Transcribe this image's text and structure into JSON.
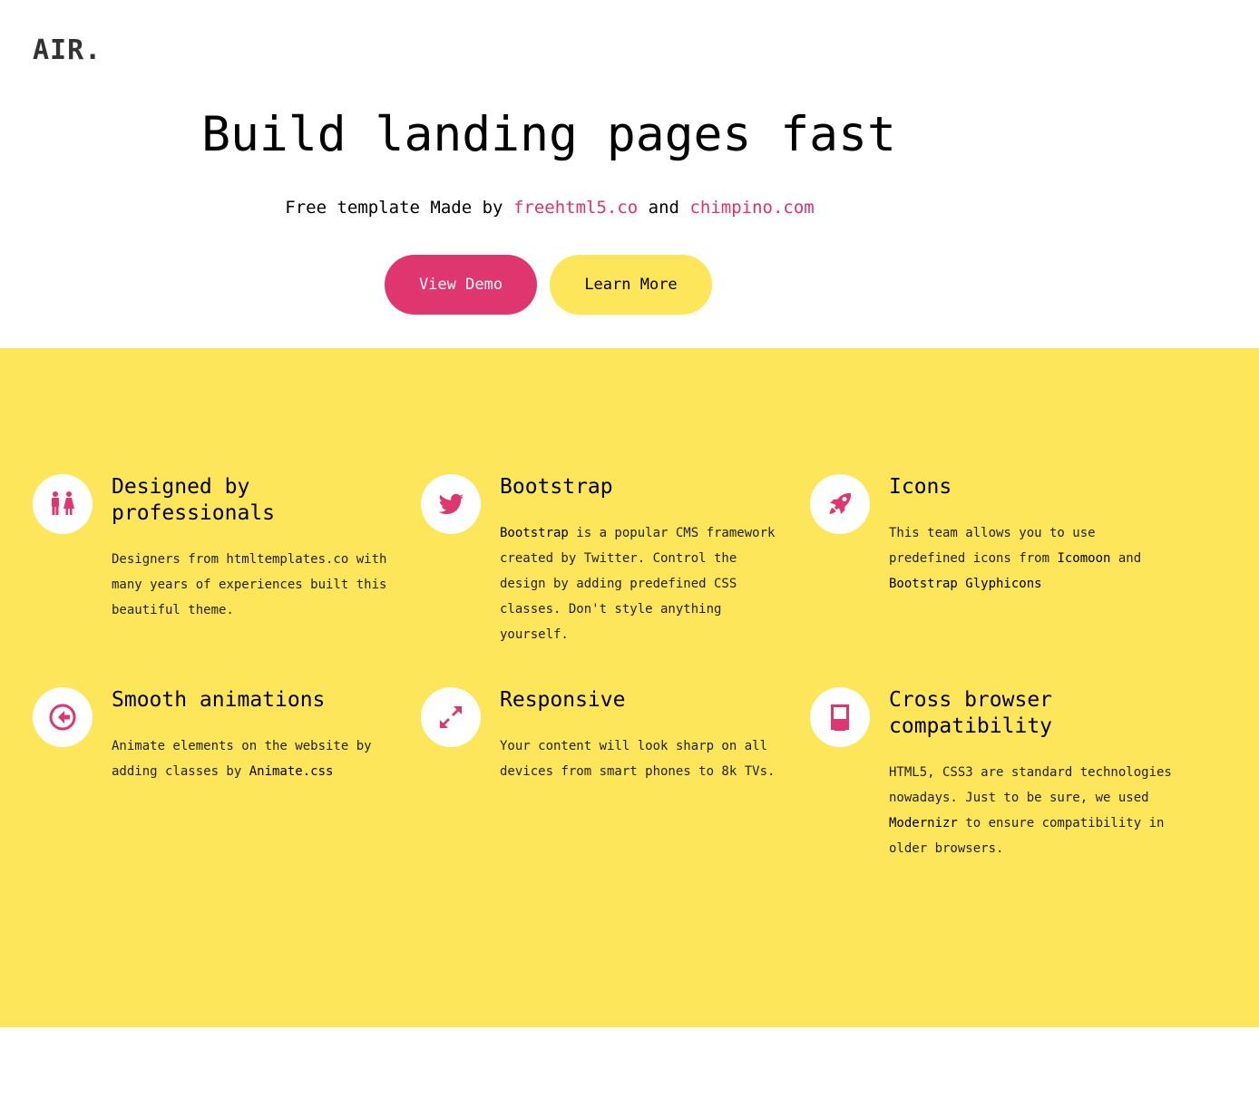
{
  "header": {
    "logo": "AIR."
  },
  "hero": {
    "title": "Build landing pages fast",
    "subtitle_prefix": "Free template Made by ",
    "link1": "freehtml5.co",
    "subtitle_middle": " and ",
    "link2": "chimpino.com",
    "btn_demo": "View Demo",
    "btn_more": "Learn More"
  },
  "colors": {
    "accent": "#e0366f",
    "yellow": "#fde65a"
  },
  "features": [
    {
      "icon": "people-icon",
      "title": "Designed by professionals",
      "text": "Designers from htmltemplates.co with many years of experiences built this beautiful theme."
    },
    {
      "icon": "twitter-icon",
      "title": "Bootstrap",
      "link": "Bootstrap",
      "text": " is a popular CMS framework created by Twitter. Control the design by adding predefined CSS classes. Don't style anything yourself."
    },
    {
      "icon": "rocket-icon",
      "title": "Icons",
      "text_a": "This team allows you to use predefined icons from ",
      "link_a": "Icomoon",
      "text_b": " and ",
      "link_b": "Bootstrap Glyphicons"
    },
    {
      "icon": "arrow-left-circle-icon",
      "title": "Smooth animations",
      "text": "Animate elements on the website by adding classes by ",
      "link": "Animate.css"
    },
    {
      "icon": "expand-icon",
      "title": "Responsive",
      "text": "Your content will look sharp on all devices from smart phones to 8k TVs."
    },
    {
      "icon": "mac-icon",
      "title": "Cross browser compatibility",
      "text_a": "HTML5, CSS3 are standard technologies nowadays. Just to be sure, we used ",
      "link": "Modernizr",
      "text_b": " to ensure compatibility in older browsers."
    }
  ]
}
